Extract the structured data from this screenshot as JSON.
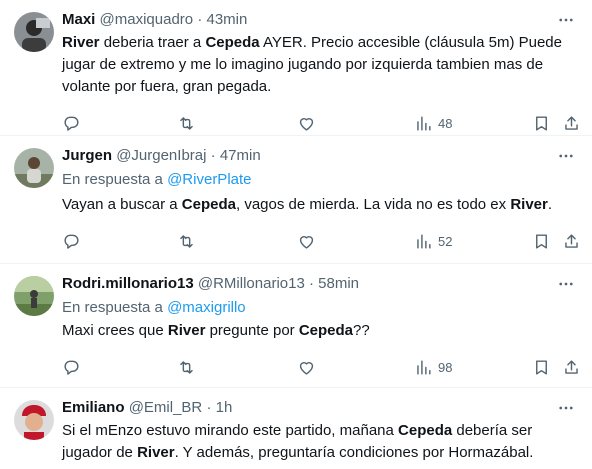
{
  "tweets": [
    {
      "display_name": "Maxi",
      "handle": "@maxiquadro",
      "sep": "·",
      "time": "43min",
      "reply_prefix": "",
      "reply_link": "",
      "text_parts": [
        "River",
        " deberia traer a ",
        "Cepeda",
        " AYER. Precio accesible (cláusula 5m) Puede jugar de extremo y me lo imagino jugando por izquierda tambien mas de volante por fuera, gran pegada."
      ],
      "views": "48"
    },
    {
      "display_name": "Jurgen",
      "handle": "@JurgenIbraj",
      "sep": "·",
      "time": "47min",
      "reply_prefix": "En respuesta a ",
      "reply_link": "@RiverPlate",
      "text_parts": [
        "Vayan a buscar a ",
        "Cepeda",
        ", vagos de mierda. La vida no es todo ex ",
        "River",
        "."
      ],
      "views": "52"
    },
    {
      "display_name": "Rodri.millonario13",
      "handle": "@RMillonario13",
      "sep": "·",
      "time": "58min",
      "reply_prefix": "En respuesta a ",
      "reply_link": "@maxigrillo",
      "text_parts": [
        "Maxi crees que ",
        "River",
        " pregunte por ",
        "Cepeda",
        "??"
      ],
      "views": "98"
    },
    {
      "display_name": "Emiliano",
      "handle": "@Emil_BR",
      "sep": "·",
      "time": "1h",
      "reply_prefix": "",
      "reply_link": "",
      "text_parts": [
        "Si el mEnzo estuvo mirando este partido, mañana ",
        "Cepeda",
        " debería ser jugador de ",
        "River",
        ". Y además, preguntaría condiciones por Hormazábal."
      ],
      "views": ""
    }
  ],
  "icons": {
    "more": "more-dots-icon",
    "reply": "reply-bubble-icon",
    "retweet": "retweet-icon",
    "like": "heart-icon",
    "views": "views-bar-icon",
    "bookmark": "bookmark-icon",
    "share": "share-icon"
  },
  "colors": {
    "text": "#0f1419",
    "muted": "#536471",
    "link": "#1d9bf0",
    "divider": "#eff3f4"
  }
}
